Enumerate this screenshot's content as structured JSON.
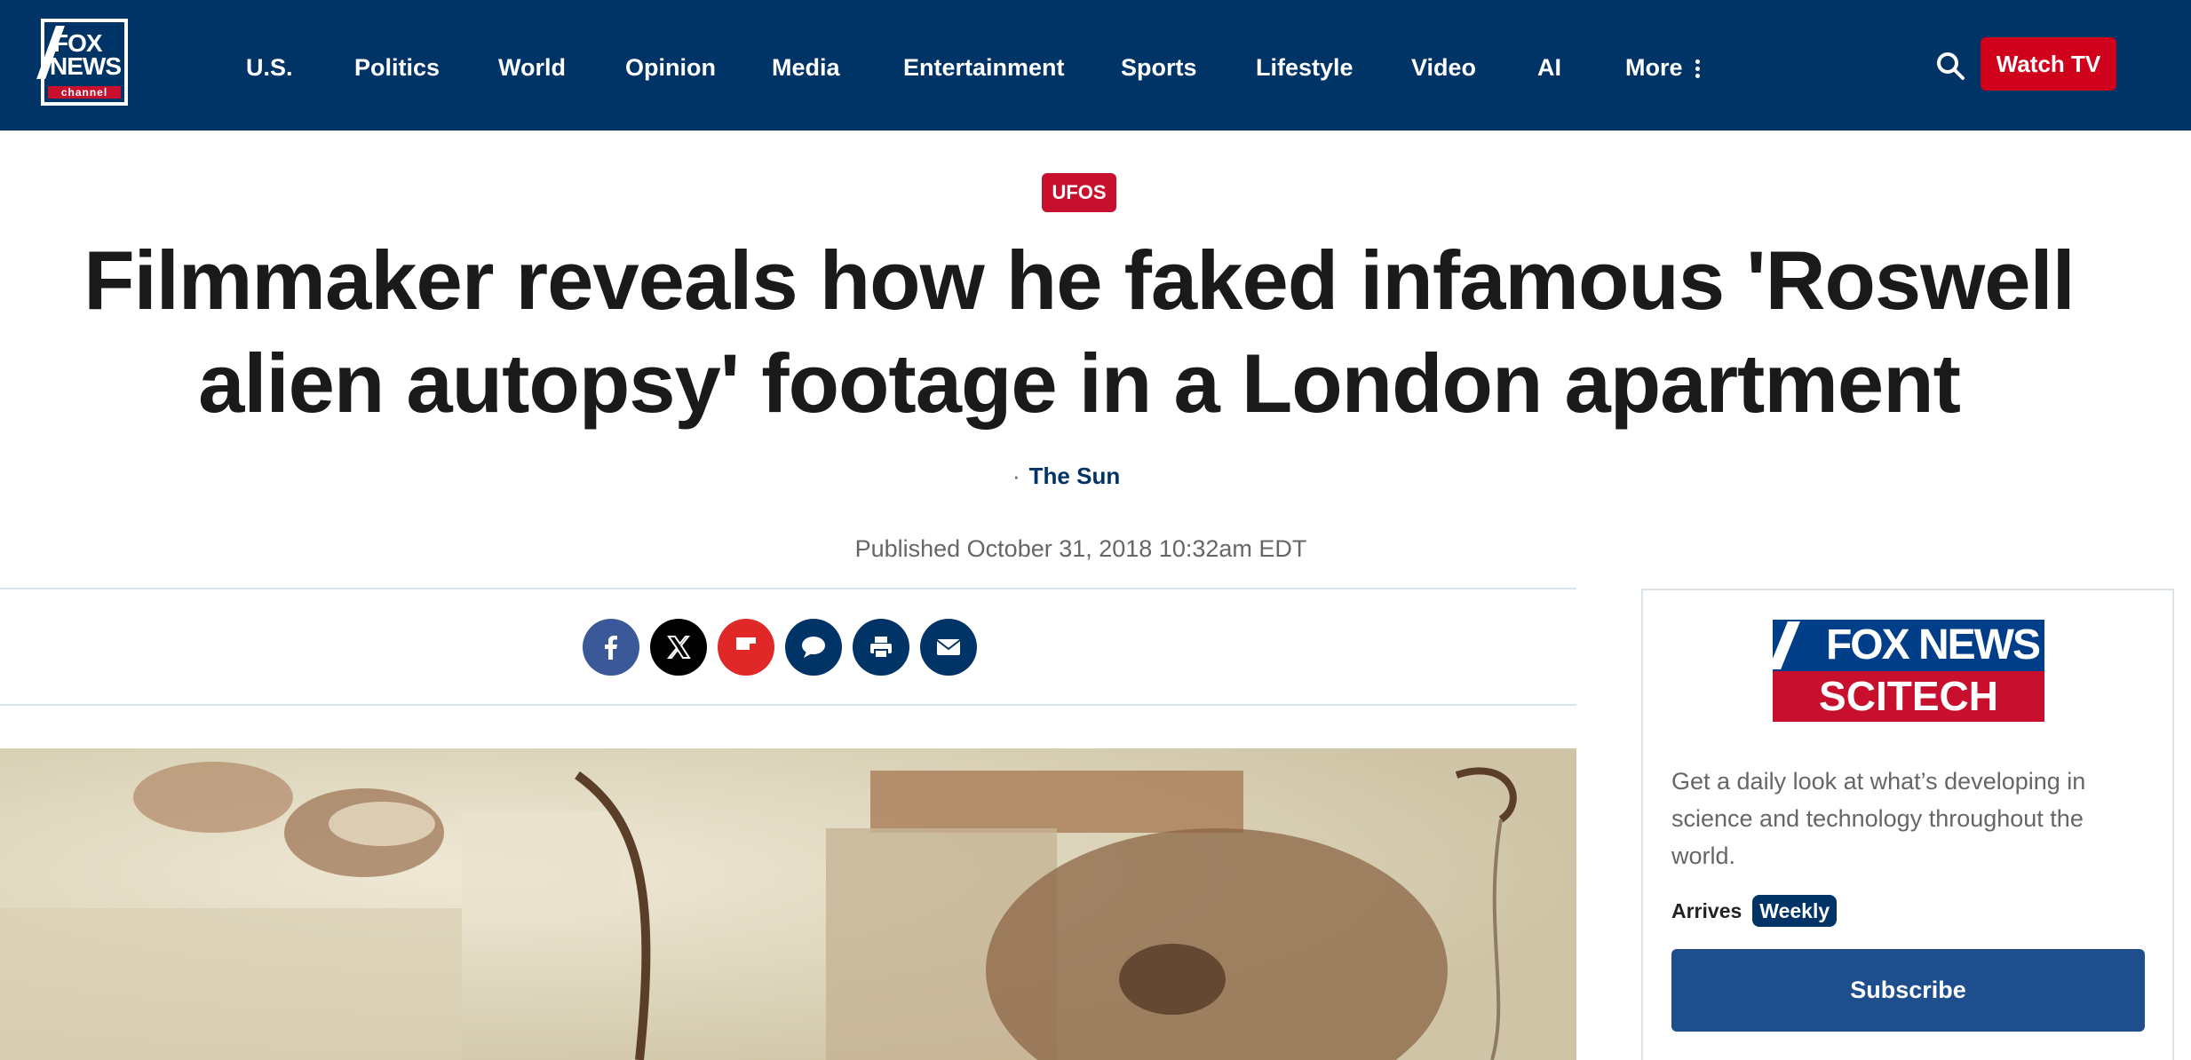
{
  "header": {
    "logo": {
      "line1": "FOX",
      "line2": "NEWS",
      "line3": "channel"
    },
    "nav": [
      {
        "label": "U.S."
      },
      {
        "label": "Politics"
      },
      {
        "label": "World"
      },
      {
        "label": "Opinion"
      },
      {
        "label": "Media"
      },
      {
        "label": "Entertainment"
      },
      {
        "label": "Sports"
      },
      {
        "label": "Lifestyle"
      },
      {
        "label": "Video"
      },
      {
        "label": "AI"
      },
      {
        "label": "More"
      }
    ],
    "search_icon": "search-icon",
    "watch_tv": "Watch TV"
  },
  "article": {
    "category": "UFOS",
    "headline": "Filmmaker reveals how he faked infamous 'Roswell alien autopsy' footage in a London apartment",
    "byline_dot": "·",
    "byline_source": "The Sun",
    "published": "Published October 31, 2018 10:32am EDT",
    "share_icons": [
      "facebook-icon",
      "x-icon",
      "flipboard-icon",
      "comments-icon",
      "print-icon",
      "email-icon"
    ]
  },
  "newsletter": {
    "logo_top": "FOX NEWS",
    "logo_bottom": "SCITECH",
    "description": "Get a daily look at what’s developing in science and technology throughout the world.",
    "arrives_label": "Arrives",
    "frequency": "Weekly",
    "subscribe": "Subscribe"
  },
  "colors": {
    "header_bg": "#003366",
    "accent_red": "#c8102e",
    "subscribe_bg": "#1f4e8c",
    "facebook": "#3b5998",
    "flipboard": "#e12828"
  }
}
